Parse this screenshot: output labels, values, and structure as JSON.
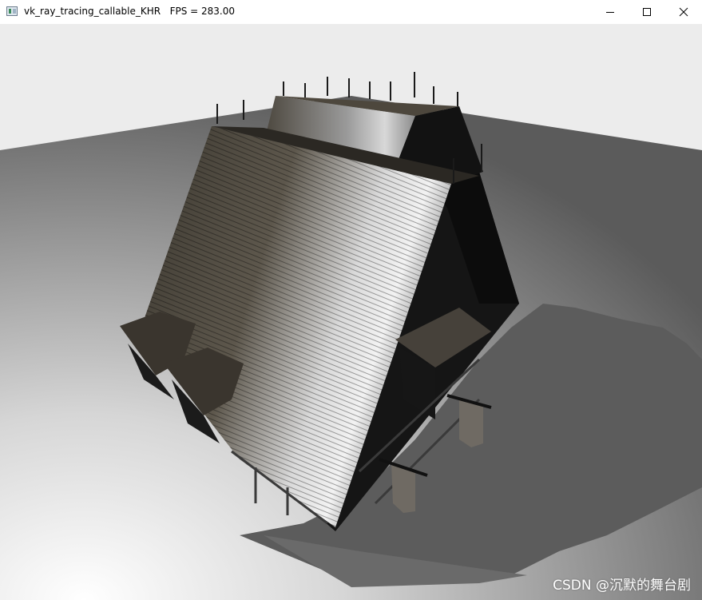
{
  "window": {
    "title": "vk_ray_tracing_callable_KHR   FPS = 283.00",
    "controls": {
      "minimize": "minimize-icon",
      "maximize": "maximize-icon",
      "close": "close-icon"
    }
  },
  "viewport": {
    "scene": "ray-traced-medieval-house",
    "watermark": "CSDN @沉默的舞台剧"
  },
  "colors": {
    "titlebar": "#ffffff",
    "sky": "#ececec",
    "floor_light": "#f4f4f4",
    "floor_dark": "#5a5a5a",
    "shadow": "#5c5c5c",
    "roof_dark": "#3e3a33",
    "roof_highlight": "#e8e8e8",
    "walls": "#1a1a1a"
  }
}
